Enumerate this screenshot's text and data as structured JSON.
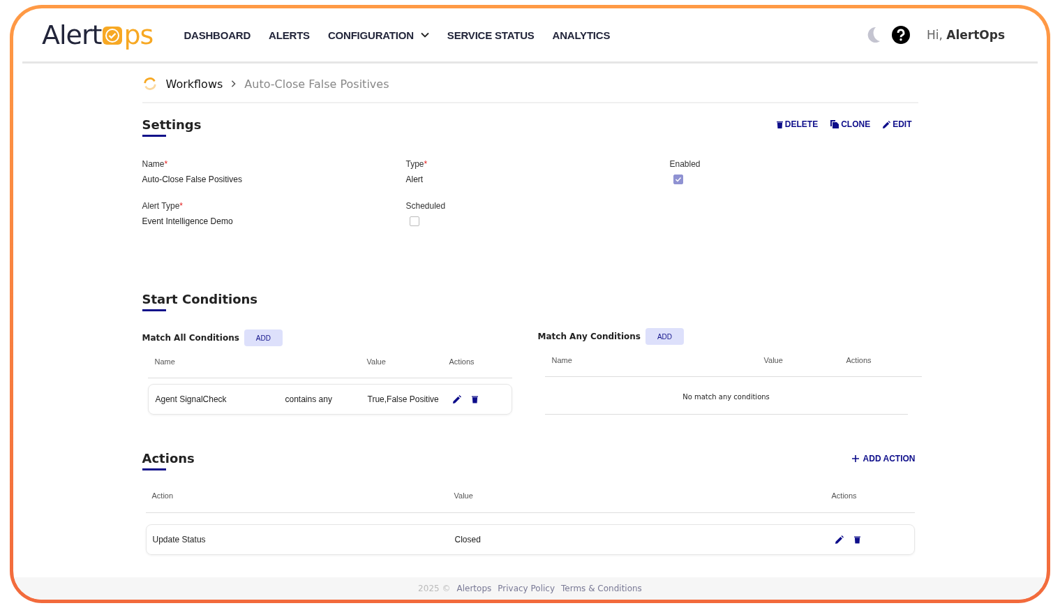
{
  "brand": {
    "name_start": "Alert",
    "name_end": "ps"
  },
  "nav": [
    {
      "label": "DASHBOARD",
      "dropdown": false
    },
    {
      "label": "ALERTS",
      "dropdown": false
    },
    {
      "label": "CONFIGURATION",
      "dropdown": true
    },
    {
      "label": "SERVICE STATUS",
      "dropdown": false
    },
    {
      "label": "ANALYTICS",
      "dropdown": false
    }
  ],
  "user": {
    "greeting": "Hi,",
    "name": "AlertOps"
  },
  "breadcrumb": {
    "parent": "Workflows",
    "current": "Auto-Close False Positives"
  },
  "settings": {
    "title": "Settings",
    "actions": [
      {
        "label": "DELETE",
        "kind": "delete"
      },
      {
        "label": "CLONE",
        "kind": "clone"
      },
      {
        "label": "EDIT",
        "kind": "edit"
      }
    ],
    "fields": [
      {
        "label": "Name",
        "required_mark": "*",
        "kind": "text",
        "value": "Auto-Close False Positives"
      },
      {
        "label": "Type",
        "required_mark": "*",
        "kind": "text",
        "value": "Alert"
      },
      {
        "label": "Enabled",
        "kind": "checkbox",
        "checked": true
      },
      {
        "label": "Alert Type",
        "required_mark": "*",
        "kind": "text",
        "value": "Event Intelligence Demo"
      },
      {
        "label": "Scheduled",
        "kind": "checkbox",
        "checked": false
      }
    ]
  },
  "start_conditions": {
    "title": "Start Conditions",
    "groups": [
      {
        "title": "Match All Conditions",
        "button": "ADD",
        "columns": [
          "Name",
          "Value",
          "Actions"
        ],
        "rows": [
          {
            "name": "Agent SignalCheck",
            "operator": "contains any",
            "value": "True,False Positive"
          }
        ]
      },
      {
        "title": "Match Any Conditions",
        "button": "ADD",
        "columns": [
          "Name",
          "Value",
          "Actions"
        ],
        "empty_text": "No match any conditions"
      }
    ]
  },
  "actions": {
    "title": "Actions",
    "add_button": "ADD ACTION",
    "columns": [
      "Action",
      "Value",
      "Actions"
    ],
    "rows": [
      {
        "action": "Update Status",
        "value": "Closed"
      }
    ]
  },
  "footer": {
    "year": "2025 ©",
    "links": [
      "Alertops",
      "Privacy Policy",
      "Terms & Conditions"
    ]
  }
}
